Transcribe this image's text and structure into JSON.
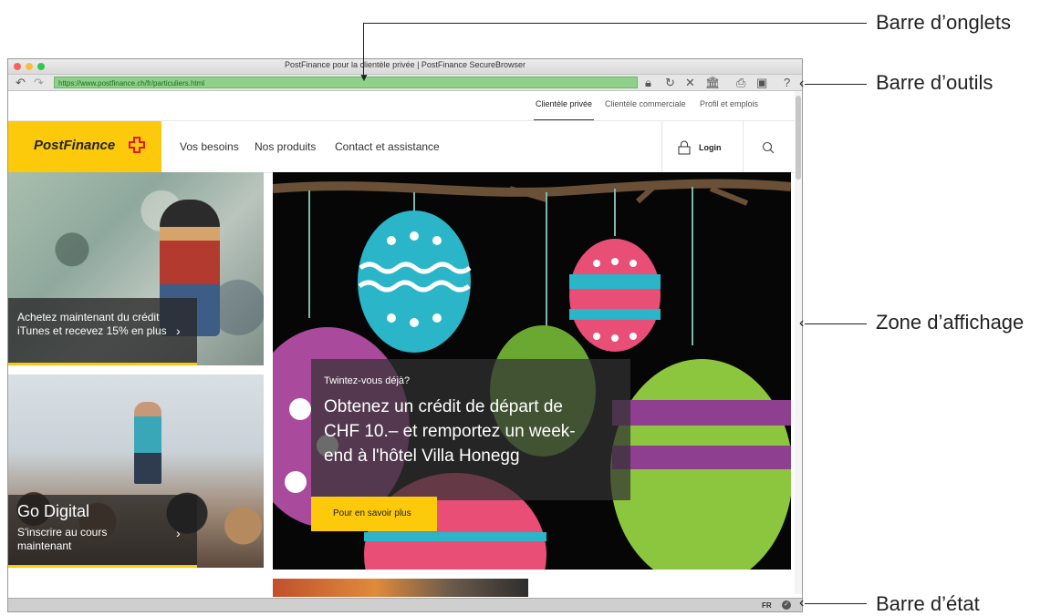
{
  "window": {
    "title": "PostFinance pour la clientèle privée | PostFinance SecureBrowser"
  },
  "toolbar": {
    "url": "https://www.postfinance.ch/fr/particuliers.html",
    "help": "?"
  },
  "top_nav": {
    "items": [
      "Clientèle privée",
      "Clientèle commerciale",
      "Profil et emplois"
    ]
  },
  "header": {
    "logo": "PostFinance",
    "nav": [
      "Vos besoins",
      "Nos produits",
      "Contact et assistance"
    ],
    "login": "Login"
  },
  "tiles": {
    "itunes": {
      "text": "Achetez maintenant du crédit iTunes et recevez 15% en plus"
    },
    "digital": {
      "title": "Go Digital",
      "text": "S'inscrire au cours maintenant"
    }
  },
  "hero": {
    "kicker": "Twintez-vous déjà?",
    "headline": "Obtenez un crédit de départ de CHF 10.– et remportez un week-end à l'hôtel Villa Honegg",
    "cta": "Pour en savoir plus"
  },
  "statusbar": {
    "lang": "FR"
  },
  "annotations": {
    "tabs": "Barre d’onglets",
    "tools": "Barre d’outils",
    "display": "Zone d’affichage",
    "status": "Barre d’état"
  }
}
